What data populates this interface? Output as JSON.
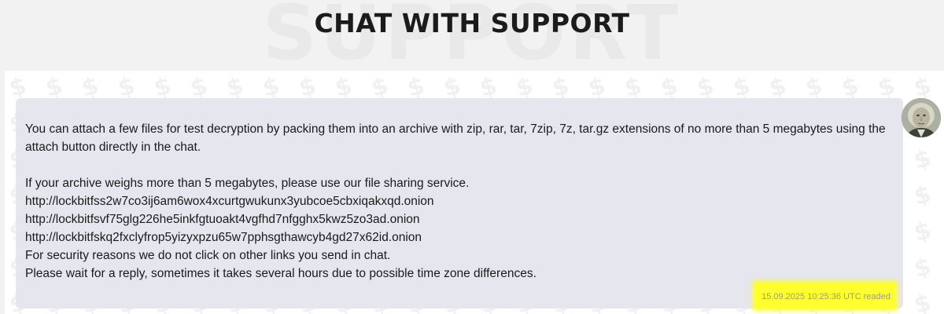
{
  "header": {
    "title": "CHAT WITH SUPPORT",
    "watermark": "SUPPORT"
  },
  "message": {
    "intro": "You can attach a few files for test decryption by packing them into an archive with zip, rar, tar, 7zip, 7z, tar.gz extensions of no more than 5 megabytes using the attach button directly in the chat.",
    "large_archive_note": "If your archive weighs more than 5 megabytes, please use our file sharing service.",
    "links": [
      "http://lockbitfss2w7co3ij6am6wox4xcurtgwukunx3yubcoe5cbxiqakxqd.onion",
      "http://lockbitfsvf75glg226he5inkfgtuoakt4vgfhd7nfgghx5kwz5zo3ad.onion",
      "http://lockbitfskq2fxclyfrop5yizyxpzu65w7pphsgthawcyb4gd27x62id.onion"
    ],
    "security_note": "For security reasons we do not click on other links you send in chat.",
    "wait_note": "Please wait for a reply, sometimes it takes several hours due to possible time zone differences.",
    "timestamp": "15.09.2025 10:25:36 UTC readed"
  },
  "avatar": {
    "icon": "banknote-portrait-avatar"
  },
  "colors": {
    "bubble": "#e6e6ef",
    "highlight": "#ffff30",
    "title": "#1b1b1b"
  }
}
